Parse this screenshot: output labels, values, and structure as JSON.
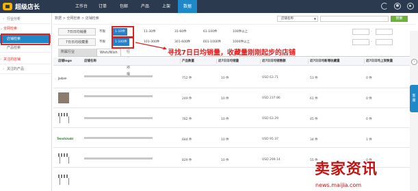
{
  "brand": {
    "name": "超级店长"
  },
  "nav": [
    "工作台",
    "订单",
    "包邮",
    "产品",
    "上架",
    "数据"
  ],
  "sidebar": {
    "items": [
      "行业分析",
      "全网检索",
      "店铺检索",
      "产品检索",
      "关注的店铺",
      "关注的产品"
    ]
  },
  "breadcrumb": "数据 > 全网检索 > 店铺检索",
  "search": {
    "select_label": "店铺名称",
    "button_label": "搜索"
  },
  "filters": {
    "row1": {
      "label": "7日日均销量",
      "options": [
        "不限",
        "1-10件",
        "11-30件",
        "31-60件",
        "61-100件",
        "100件以上"
      ]
    },
    "row2": {
      "label": "7日日均收藏量",
      "options": [
        "不限",
        "1-100件",
        "101-300件",
        "301-600件",
        "601-1000件",
        "1000件以上"
      ]
    },
    "range_dash": "-"
  },
  "tabs": [
    "所属行业",
    "Wish/Wish",
    "行业选择"
  ],
  "table": {
    "headers": [
      "店铺logo",
      "店铺名称",
      "产品数量",
      "近7日日均销量",
      "近7日日均销售额",
      "近7日日均新增收藏量",
      "近7日日均上架数量"
    ],
    "rows": [
      {
        "products": "752 件",
        "sales": "10 件",
        "revenue": "USD 63.71",
        "favorites": "53 件",
        "listed": "0 件"
      },
      {
        "products": "249 件",
        "sales": "10 件",
        "revenue": "USD 237.86",
        "favorites": "61 件",
        "listed": "0 件"
      },
      {
        "products": "782 件",
        "sales": "10 件",
        "revenue": "USD 63.29",
        "favorites": "45 件",
        "listed": "0 件"
      },
      {
        "products": "684 件",
        "sales": "10 件",
        "revenue": "USD 95.37",
        "favorites": "34 件",
        "listed": "1 件"
      },
      {
        "products": "829 件",
        "sales": "10 件",
        "revenue": "USD 299.14",
        "favorites": "55 件",
        "listed": "0 件"
      }
    ],
    "logos": [
      "Jadam",
      "",
      "",
      "Tenshinabi",
      ""
    ]
  },
  "annotation": "寻找7日日均销量，收藏量刚刚起步的店铺",
  "float_button": "客服",
  "watermark": {
    "title": "卖家资讯",
    "url": "news.maijia.com"
  },
  "colors": {
    "topbar": "#2b3a4e",
    "accent": "#1e88c8",
    "highlight": "#e02020",
    "search_button": "#6cb33e"
  }
}
